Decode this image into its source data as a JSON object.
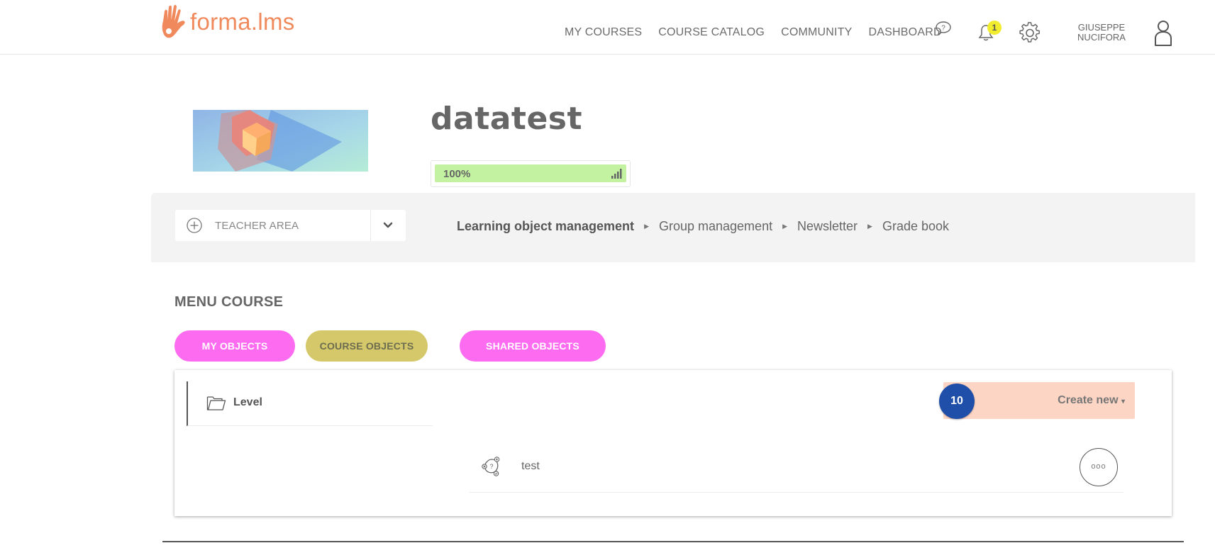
{
  "header": {
    "logo_text": "forma.lms",
    "nav": [
      "MY COURSES",
      "COURSE CATALOG",
      "COMMUNITY",
      "DASHBOARD"
    ],
    "notification_count": "1",
    "user_first": "GIUSEPPE",
    "user_last": "NUCIFORA",
    "icons": [
      "help-chat-icon",
      "bell-icon",
      "gear-icon",
      "user-icon"
    ]
  },
  "course": {
    "title": "datatest",
    "progress_label": "100%",
    "progress_value": 1.0
  },
  "teacher": {
    "select_label": "TEACHER AREA",
    "breadcrumbs": [
      "Learning object management",
      "Group management",
      "Newsletter",
      "Grade book"
    ]
  },
  "menu": {
    "title": "MENU COURSE",
    "tabs": [
      "MY OBJECTS",
      "COURSE OBJECTS",
      "SHARED OBJECTS"
    ]
  },
  "panel": {
    "level_label": "Level",
    "count": "10",
    "create_label": "Create new",
    "objects": [
      {
        "name": "test"
      }
    ],
    "more_label": "ooo"
  },
  "colors": {
    "brand": "#f08a5d",
    "pill_pink": "#fd6cf0",
    "pill_olive": "#d4c86a",
    "progress": "#c3f2a0",
    "create_bg": "#fdd5c4",
    "count_circle": "#1f4fa8",
    "badge": "#f2ec2e"
  }
}
